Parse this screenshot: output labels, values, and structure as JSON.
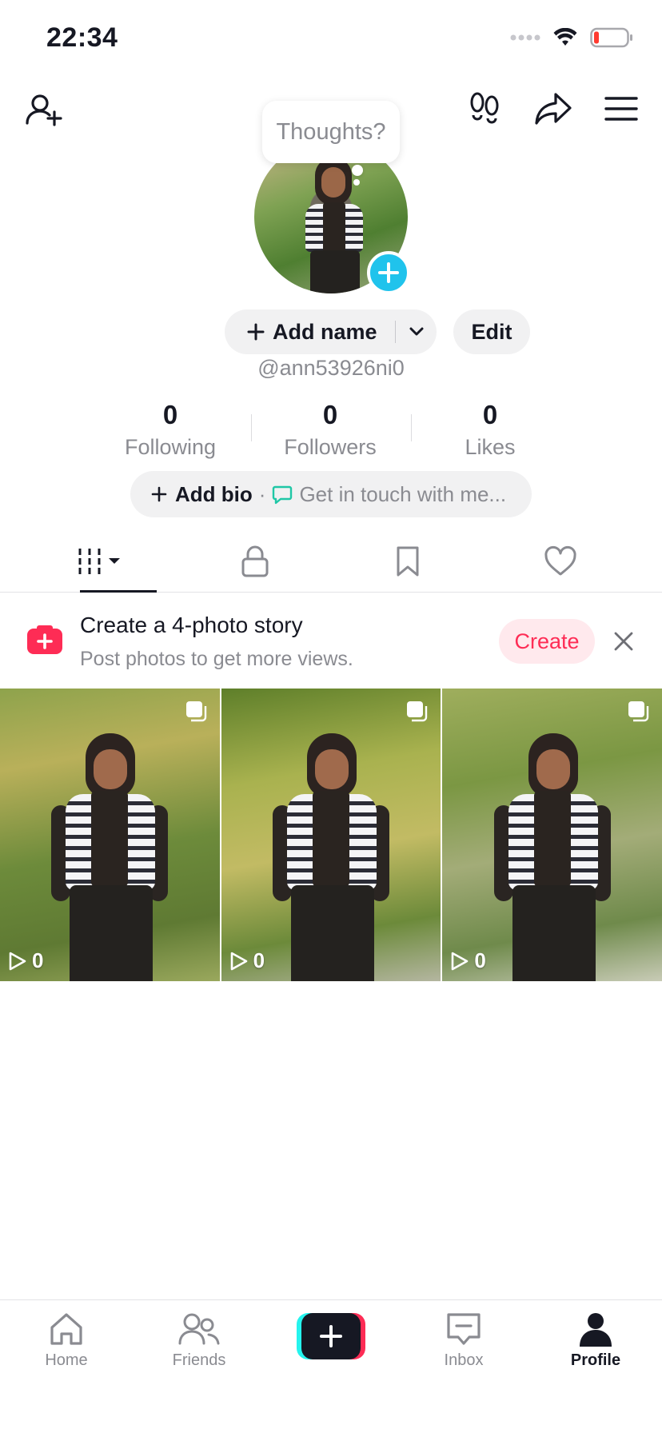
{
  "status_bar": {
    "time": "22:34"
  },
  "profile": {
    "thought_bubble": "Thoughts?",
    "add_name_label": "Add name",
    "edit_label": "Edit",
    "handle": "@ann53926ni0",
    "stats": [
      {
        "value": "0",
        "label": "Following"
      },
      {
        "value": "0",
        "label": "Followers"
      },
      {
        "value": "0",
        "label": "Likes"
      }
    ],
    "add_bio_label": "Add bio",
    "bio_separator": "·",
    "contact_label": "Get in touch with me..."
  },
  "tabs": [
    {
      "icon": "grid-icon",
      "active": true
    },
    {
      "icon": "lock-icon",
      "active": false
    },
    {
      "icon": "bookmark-icon",
      "active": false
    },
    {
      "icon": "heart-icon",
      "active": false
    }
  ],
  "promo": {
    "title": "Create a 4-photo story",
    "subtitle": "Post photos to get more views.",
    "button_label": "Create"
  },
  "videos": [
    {
      "views": "0"
    },
    {
      "views": "0"
    },
    {
      "views": "0"
    }
  ],
  "bottom_nav": [
    {
      "label": "Home",
      "icon": "home-icon",
      "active": false
    },
    {
      "label": "Friends",
      "icon": "friends-icon",
      "active": false
    },
    {
      "label": "",
      "icon": "create-plus-icon",
      "active": false
    },
    {
      "label": "Inbox",
      "icon": "inbox-icon",
      "active": false
    },
    {
      "label": "Profile",
      "icon": "profile-icon",
      "active": true
    }
  ],
  "colors": {
    "accent_red": "#fe2c55",
    "accent_cyan": "#25f4ee",
    "avatar_plus_blue": "#20c3ec",
    "text_primary": "#161823",
    "text_secondary": "#8a8b91"
  }
}
